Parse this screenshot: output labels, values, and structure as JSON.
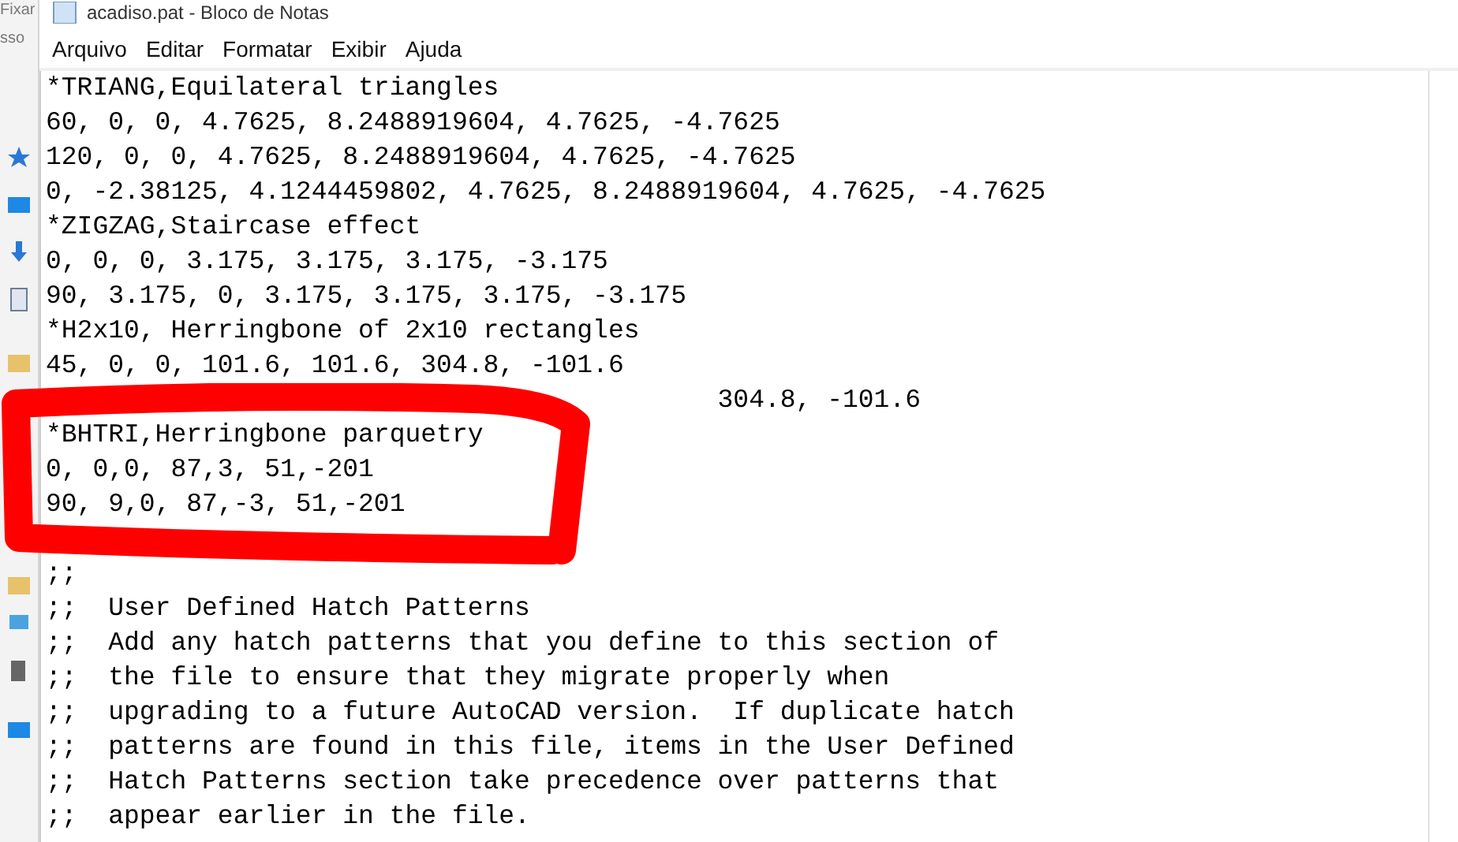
{
  "sidebar": {
    "labels": [
      "Fixar",
      "sso"
    ]
  },
  "window": {
    "title": "acadiso.pat - Bloco de Notas"
  },
  "menu": [
    "Arquivo",
    "Editar",
    "Formatar",
    "Exibir",
    "Ajuda"
  ],
  "editor": {
    "lines": [
      "*TRIANG,Equilateral triangles",
      "60, 0, 0, 4.7625, 8.2488919604, 4.7625, -4.7625",
      "120, 0, 0, 4.7625, 8.2488919604, 4.7625, -4.7625",
      "0, -2.38125, 4.1244459802, 4.7625, 8.2488919604, 4.7625, -4.7625",
      "*ZIGZAG,Staircase effect",
      "0, 0, 0, 3.175, 3.175, 3.175, -3.175",
      "90, 3.175, 0, 3.175, 3.175, 3.175, -3.175",
      "*H2x10, Herringbone of 2x10 rectangles",
      "45, 0, 0, 101.6, 101.6, 304.8, -101.6",
      "                                           304.8, -101.6",
      "*BHTRI,Herringbone parquetry",
      "0, 0,0, 87,3, 51,-201",
      "90, 9,0, 87,-3, 51,-201",
      {
        "kind": "blank"
      },
      ";;",
      ";;  User Defined Hatch Patterns",
      ";;  Add any hatch patterns that you define to this section of",
      ";;  the file to ensure that they migrate properly when",
      ";;  upgrading to a future AutoCAD version.  If duplicate hatch",
      ";;  patterns are found in this file, items in the User Defined",
      ";;  Hatch Patterns section take precedence over patterns that",
      ";;  appear earlier in the file."
    ]
  }
}
